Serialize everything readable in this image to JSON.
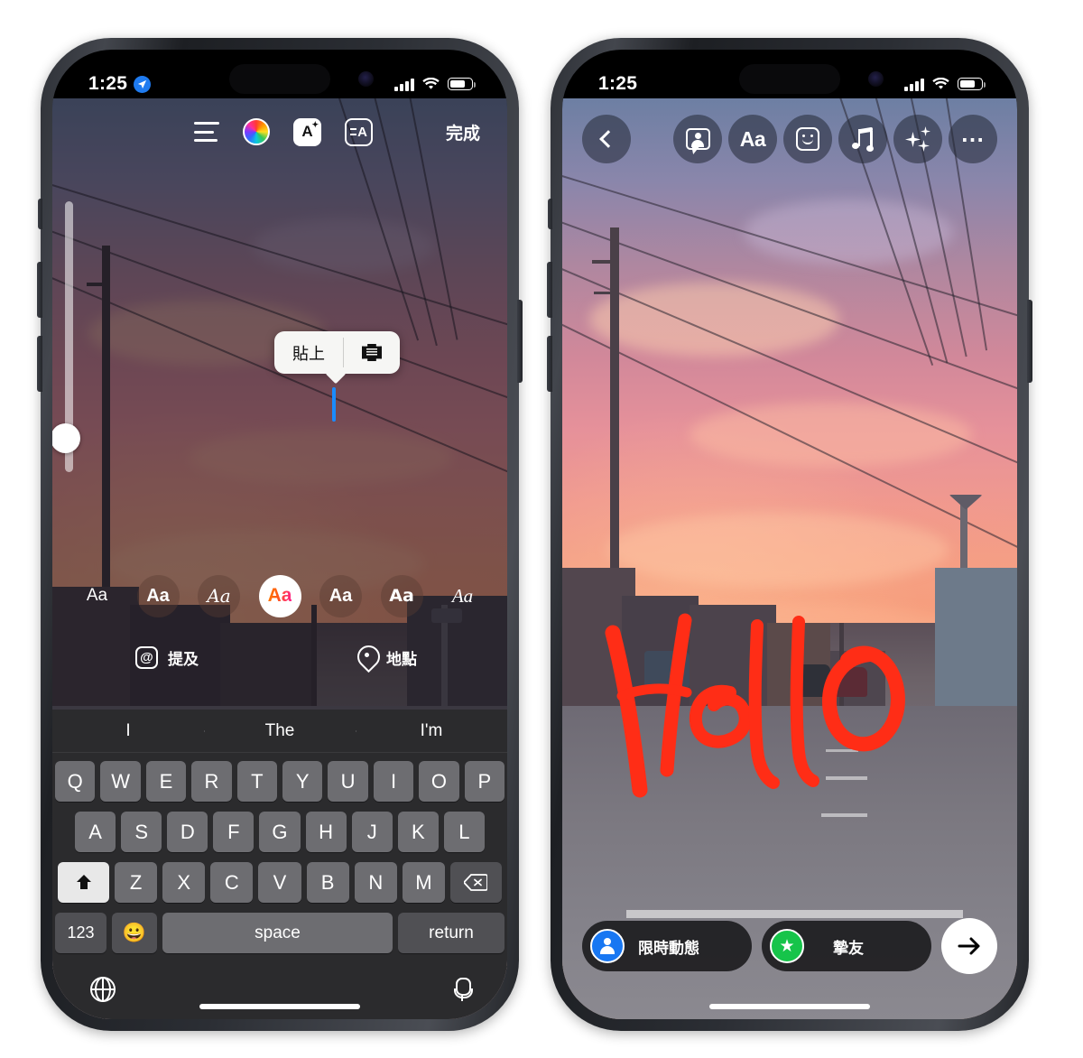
{
  "left_phone": {
    "status_bar": {
      "time": "1:25",
      "location_icon": "location-arrow-icon",
      "signal_icon": "cellular-bars-icon",
      "wifi_icon": "wifi-icon",
      "battery_icon": "battery-icon"
    },
    "edit_toolbar": {
      "align_icon": "text-align-icon",
      "color_icon": "color-wheel-icon",
      "effects_icon": "text-effects-icon",
      "background_icon": "text-background-icon",
      "done_label": "完成"
    },
    "paste_popup": {
      "paste_label": "貼上",
      "scan_icon": "scan-text-icon"
    },
    "caret": "text-cursor",
    "edge_slider": "size-slider",
    "fonts": [
      {
        "sample": "Aa",
        "style": "classic",
        "selected": false
      },
      {
        "sample": "Aa",
        "style": "modern",
        "selected": false
      },
      {
        "sample": "Aa",
        "style": "script",
        "selected": false
      },
      {
        "sample": "Aa",
        "style": "neon",
        "selected": true
      },
      {
        "sample": "Aa",
        "style": "typewriter",
        "selected": false
      },
      {
        "sample": "Aa",
        "style": "strong",
        "selected": false
      },
      {
        "sample": "Aa",
        "style": "serif-italic",
        "selected": false
      }
    ],
    "tools": {
      "mention_label": "提及",
      "mention_icon": "at-sign-icon",
      "location_label": "地點",
      "location_icon": "map-pin-icon"
    },
    "keyboard": {
      "predictions": [
        "I",
        "The",
        "I'm"
      ],
      "row1": [
        "Q",
        "W",
        "E",
        "R",
        "T",
        "Y",
        "U",
        "I",
        "O",
        "P"
      ],
      "row2": [
        "A",
        "S",
        "D",
        "F",
        "G",
        "H",
        "J",
        "K",
        "L"
      ],
      "row3": [
        "Z",
        "X",
        "C",
        "V",
        "B",
        "N",
        "M"
      ],
      "shift_icon": "shift-arrow-icon",
      "backspace_icon": "backspace-icon",
      "numbers_label": "123",
      "emoji_icon": "emoji-face-icon",
      "space_label": "space",
      "return_label": "return",
      "globe_icon": "globe-icon",
      "mic_icon": "microphone-icon"
    }
  },
  "right_phone": {
    "status_bar": {
      "time": "1:25",
      "signal_icon": "cellular-bars-icon",
      "wifi_icon": "wifi-icon",
      "battery_icon": "battery-icon"
    },
    "toolbar": {
      "back_icon": "chevron-left-icon",
      "items": [
        {
          "icon": "tag-people-icon",
          "label": ""
        },
        {
          "icon": "text-aa-icon",
          "label": "Aa"
        },
        {
          "icon": "sticker-icon",
          "label": ""
        },
        {
          "icon": "music-note-icon",
          "label": ""
        },
        {
          "icon": "sparkle-icon",
          "label": ""
        },
        {
          "icon": "more-dots-icon",
          "label": ""
        }
      ]
    },
    "drawing": {
      "text": "Hello",
      "color": "#FF2D16",
      "type": "handwritten-marker"
    },
    "bottom_bar": {
      "story_label": "限時動態",
      "story_icon": "story-avatar-icon",
      "close_friends_label": "摯友",
      "close_friends_icon": "green-star-icon",
      "send_icon": "arrow-right-icon"
    }
  },
  "colors": {
    "accent_blue": "#1877f2",
    "close_friends_green": "#16c44a",
    "marker_red": "#FF2D16",
    "caret_blue": "#1a8cff"
  }
}
